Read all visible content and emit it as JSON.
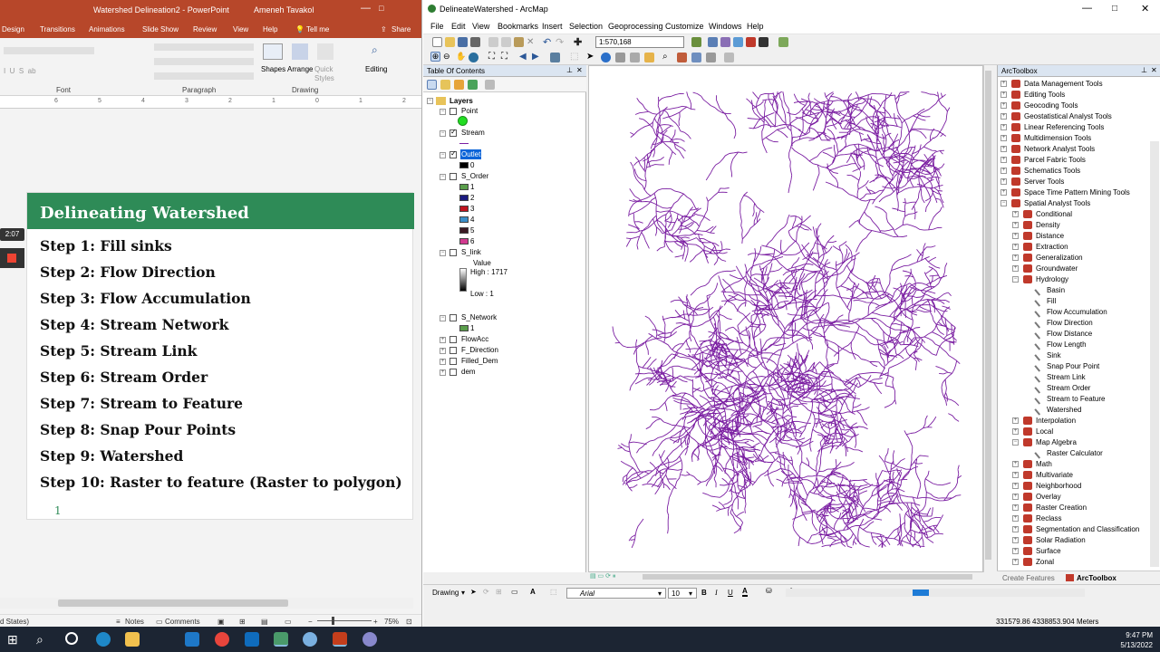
{
  "ppt": {
    "doc_title": "Watershed Delineation2 - PowerPoint",
    "user": "Ameneh Tavakol",
    "tabs": [
      "Design",
      "Transitions",
      "Animations",
      "Slide Show",
      "Review",
      "View",
      "Help",
      "Tell me",
      "Share"
    ],
    "groups": {
      "font": "Font",
      "paragraph": "Paragraph",
      "drawing": "Drawing",
      "shapes": "Shapes",
      "arrange": "Arrange",
      "quick_styles": "Quick Styles",
      "editing": "Editing"
    },
    "ruler": [
      "6",
      "5",
      "4",
      "3",
      "2",
      "1",
      "0",
      "1",
      "2"
    ],
    "slide": {
      "heading": "Delineating Watershed",
      "steps": [
        "Step 1: Fill sinks",
        "Step 2: Flow Direction",
        "Step 3: Flow Accumulation",
        "Step 4: Stream Network",
        "Step 5: Stream Link",
        "Step 6: Stream Order",
        "Step 7: Stream to Feature",
        "Step 8: Snap Pour Points",
        "Step 9: Watershed",
        "Step 10: Raster to feature (Raster to polygon)"
      ],
      "number": "1"
    },
    "timer": "2:07",
    "status": {
      "lang": "d States)",
      "notes": "Notes",
      "comments": "Comments",
      "zoom": "75%"
    }
  },
  "arc": {
    "title": "DelineateWatershed - ArcMap",
    "menu": [
      "File",
      "Edit",
      "View",
      "Bookmarks",
      "Insert",
      "Selection",
      "Geoprocessing",
      "Customize",
      "Windows",
      "Help"
    ],
    "scale": "1:570,168",
    "toc": {
      "title": "Table Of Contents",
      "root": "Layers",
      "layers": [
        {
          "name": "Point",
          "checked": false
        },
        {
          "name": "Stream",
          "checked": true
        },
        {
          "name": "Outlet",
          "checked": true,
          "value": "0"
        },
        {
          "name": "S_Order",
          "checked": false,
          "classes": [
            "1",
            "2",
            "3",
            "4",
            "5",
            "6"
          ]
        },
        {
          "name": "S_link",
          "checked": false,
          "value_label": "Value",
          "high": "High : 1717",
          "low": "Low : 1"
        },
        {
          "name": "S_Network",
          "checked": false,
          "value": "1"
        },
        {
          "name": "FlowAcc",
          "checked": false
        },
        {
          "name": "F_Direction",
          "checked": false
        },
        {
          "name": "Filled_Dem",
          "checked": false
        },
        {
          "name": "dem",
          "checked": false
        }
      ],
      "order_colors": [
        "#5a9e4b",
        "#1b1b80",
        "#c0141e",
        "#3b8fc9",
        "#3a1a24",
        "#d13a8f"
      ]
    },
    "toolbox": {
      "title": "ArcToolbox",
      "top_tools": [
        "Data Management Tools",
        "Editing Tools",
        "Geocoding Tools",
        "Geostatistical Analyst Tools",
        "Linear Referencing Tools",
        "Multidimension Tools",
        "Network Analyst Tools",
        "Parcel Fabric Tools",
        "Schematics Tools",
        "Server Tools",
        "Space Time Pattern Mining Tools",
        "Spatial Analyst Tools"
      ],
      "sa_before": [
        "Conditional",
        "Density",
        "Distance",
        "Extraction",
        "Generalization",
        "Groundwater",
        "Hydrology"
      ],
      "hydrology": [
        "Basin",
        "Fill",
        "Flow Accumulation",
        "Flow Direction",
        "Flow Distance",
        "Flow Length",
        "Sink",
        "Snap Pour Point",
        "Stream Link",
        "Stream Order",
        "Stream to Feature",
        "Watershed"
      ],
      "sa_mid": [
        "Interpolation",
        "Local",
        "Map Algebra"
      ],
      "map_algebra": [
        "Raster Calculator"
      ],
      "sa_after": [
        "Math",
        "Multivariate",
        "Neighborhood",
        "Overlay",
        "Raster Creation",
        "Reclass",
        "Segmentation and Classification",
        "Solar Radiation",
        "Surface",
        "Zonal"
      ],
      "tabs": [
        "Create Features",
        "ArcToolbox"
      ]
    },
    "drawing": {
      "label": "Drawing",
      "font": "Arial",
      "size": "10",
      "bold": "B",
      "italic": "I",
      "underline": "U"
    },
    "coords": "331579.86  4338853.904 Meters",
    "stream_color": "#7b1fa2"
  },
  "taskbar": {
    "time": "9:47 PM",
    "date": "5/13/2022"
  }
}
